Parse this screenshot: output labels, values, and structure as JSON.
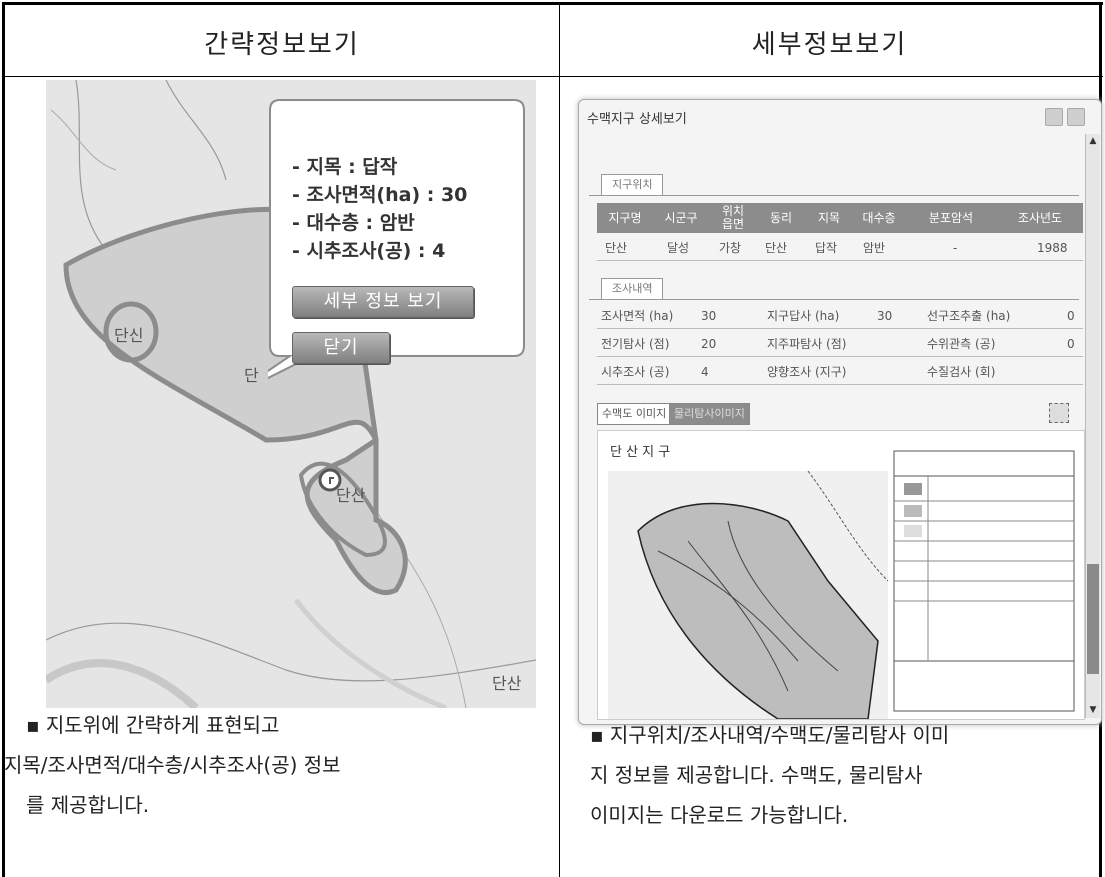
{
  "headers": {
    "left": "간략정보보기",
    "right": "세부정보보기"
  },
  "map": {
    "callout_lines": [
      "- 지목 : 답작",
      "- 조사면적(ha) : 30",
      "- 대수층 : 암반",
      "- 시추조사(공) : 4"
    ],
    "detail_button": "세부 정보 보기",
    "close_button": "닫기",
    "labels": [
      "단산",
      "단",
      "단산",
      "단신"
    ]
  },
  "left_desc": [
    "▪ 지도위에 간략하게 표현되고",
    "  지목/조사면적/대수층/시추조사(공) 정보",
    "를 제공합니다."
  ],
  "window": {
    "title": "수맥지구 상세보기",
    "tab_location": "지구위치",
    "table_headers": [
      "지구명",
      "시군구",
      "위치\n읍면",
      "동리",
      "지목",
      "대수층",
      "분포암석",
      "조사년도"
    ],
    "table_row": [
      "단산",
      "달성",
      "가창",
      "단산",
      "답작",
      "암반",
      "-",
      "1988"
    ],
    "tab_survey": "조사내역",
    "survey_rows": [
      [
        "조사면적 (ha)",
        "30",
        "지구답사 (ha)",
        "30",
        "선구조추출 (ha)",
        "0"
      ],
      [
        "전기탐사 (점)",
        "20",
        "지주파탐사 (점)",
        "",
        "수위관측 (공)",
        "0"
      ],
      [
        "시추조사 (공)",
        "4",
        "양향조사 (지구)",
        "",
        "수질검사 (회)",
        ""
      ]
    ],
    "image_tabs": [
      "수맥도 이미지",
      "물리탐사이미지"
    ],
    "map_title": "단 산 지 구"
  },
  "right_desc": [
    "▪ 지구위치/조사내역/수맥도/물리탐사 이미",
    "지 정보를 제공합니다. 수맥도, 물리탐사",
    "이미지는 다운로드 가능합니다."
  ]
}
